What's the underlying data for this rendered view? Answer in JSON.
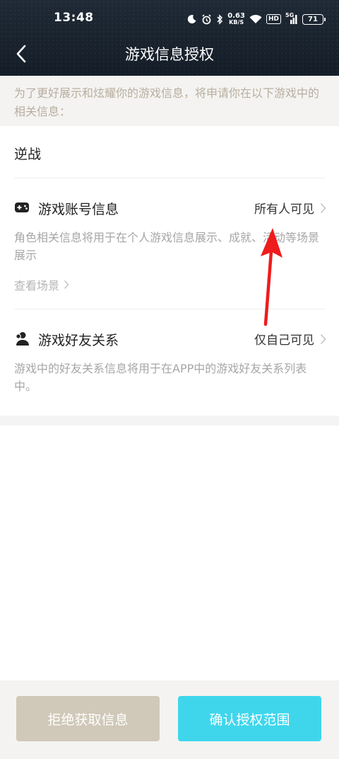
{
  "status_bar": {
    "time": "13:48",
    "net_speed_value": "0.63",
    "net_speed_unit": "KB/S",
    "hd": "HD",
    "network": "5G",
    "battery": "71"
  },
  "nav": {
    "title": "游戏信息授权"
  },
  "notice": {
    "text": "为了更好展示和炫耀你的游戏信息，将申请你在以下游戏中的相关信息："
  },
  "game": {
    "name": "逆战"
  },
  "permissions": [
    {
      "icon": "gamepad-icon",
      "title": "游戏账号信息",
      "value": "所有人可见",
      "description": "角色相关信息将用于在个人游戏信息展示、成就、活动等场景展示",
      "link": "查看场景"
    },
    {
      "icon": "friends-icon",
      "title": "游戏好友关系",
      "value": "仅自己可见",
      "description": "游戏中的好友关系信息将用于在APP中的游戏好友关系列表中。"
    }
  ],
  "footer": {
    "reject_label": "拒绝获取信息",
    "confirm_label": "确认授权范围"
  },
  "colors": {
    "header_bg": "#1b2530",
    "notice_text": "#b8ae9f",
    "reject_button": "#d0c8b8",
    "confirm_button": "#3fd6ec",
    "annotation_arrow": "#ee1c1c"
  }
}
